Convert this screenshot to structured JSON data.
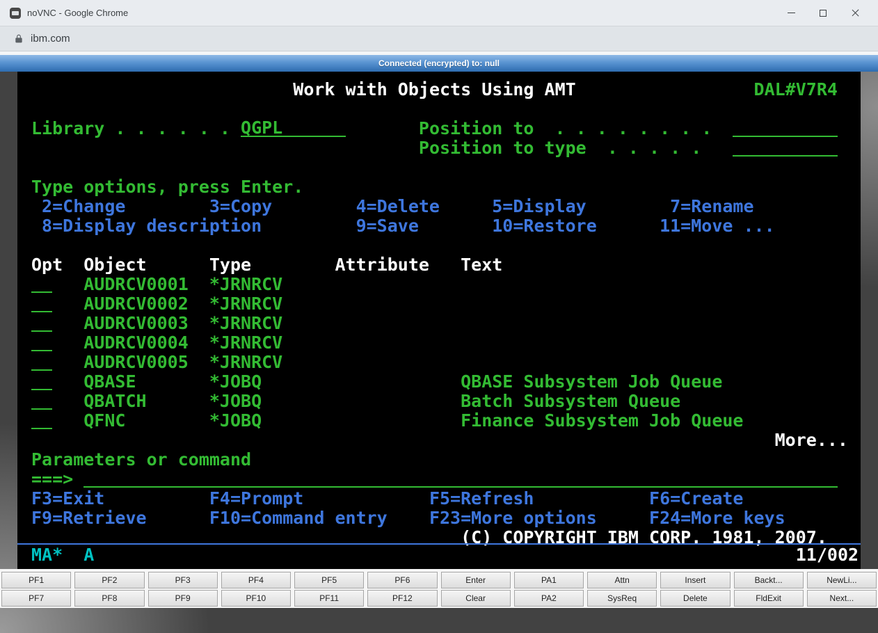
{
  "window": {
    "title": "noVNC - Google Chrome",
    "url": "ibm.com"
  },
  "icons": {
    "app-icon": "novnc-logo",
    "lock-icon": "padlock",
    "minimize-icon": "horizontal-bar",
    "maximize-icon": "square",
    "close-icon": "x-cross"
  },
  "vnc": {
    "status": "Connected (encrypted) to: null"
  },
  "terminal": {
    "title": "Work with Objects Using AMT",
    "system_id": "DAL#V7R4",
    "library": {
      "label": "Library . . . . . .",
      "value": "QGPL"
    },
    "position_to": {
      "label": "Position to  . . . . . . . .",
      "value": ""
    },
    "position_to_type": {
      "label": "Position to type  . . . . .",
      "value": ""
    },
    "options_prompt": "Type options, press Enter.",
    "options_row1": [
      "2=Change",
      "3=Copy",
      "4=Delete",
      "5=Display",
      "7=Rename"
    ],
    "options_row2": [
      "8=Display description",
      "9=Save",
      "10=Restore",
      "11=Move ..."
    ],
    "columns": [
      "Opt",
      "Object",
      "Type",
      "Attribute",
      "Text"
    ],
    "rows": [
      {
        "opt": "",
        "object": "AUDRCV0001",
        "type": "*JRNRCV",
        "attribute": "",
        "text": ""
      },
      {
        "opt": "",
        "object": "AUDRCV0002",
        "type": "*JRNRCV",
        "attribute": "",
        "text": ""
      },
      {
        "opt": "",
        "object": "AUDRCV0003",
        "type": "*JRNRCV",
        "attribute": "",
        "text": ""
      },
      {
        "opt": "",
        "object": "AUDRCV0004",
        "type": "*JRNRCV",
        "attribute": "",
        "text": ""
      },
      {
        "opt": "",
        "object": "AUDRCV0005",
        "type": "*JRNRCV",
        "attribute": "",
        "text": ""
      },
      {
        "opt": "",
        "object": "QBASE",
        "type": "*JOBQ",
        "attribute": "",
        "text": "QBASE Subsystem Job Queue"
      },
      {
        "opt": "",
        "object": "QBATCH",
        "type": "*JOBQ",
        "attribute": "",
        "text": "Batch Subsystem Queue"
      },
      {
        "opt": "",
        "object": "QFNC",
        "type": "*JOBQ",
        "attribute": "",
        "text": "Finance Subsystem Job Queue"
      }
    ],
    "more": "More...",
    "command": {
      "label": "Parameters or command",
      "prompt": "===>",
      "value": ""
    },
    "fkeys_row1": [
      "F3=Exit",
      "F4=Prompt",
      "F5=Refresh",
      "F6=Create"
    ],
    "fkeys_row2": [
      "F9=Retrieve",
      "F10=Command entry",
      "F23=More options",
      "F24=More keys"
    ],
    "copyright": "(C) COPYRIGHT IBM CORP. 1981, 2007.",
    "status": {
      "left": "MA*",
      "mode": "A",
      "cursor": "11/002"
    },
    "colors": {
      "green": "#33bb33",
      "blue": "#3e76dd",
      "white": "#ffffff",
      "cyan": "#00c2c2"
    }
  },
  "keyboard": {
    "row1": [
      "PF1",
      "PF2",
      "PF3",
      "PF4",
      "PF5",
      "PF6",
      "Enter",
      "PA1",
      "Attn",
      "Insert",
      "Backt...",
      "NewLi..."
    ],
    "row2": [
      "PF7",
      "PF8",
      "PF9",
      "PF10",
      "PF11",
      "PF12",
      "Clear",
      "PA2",
      "SysReq",
      "Delete",
      "FldExit",
      "Next..."
    ]
  }
}
